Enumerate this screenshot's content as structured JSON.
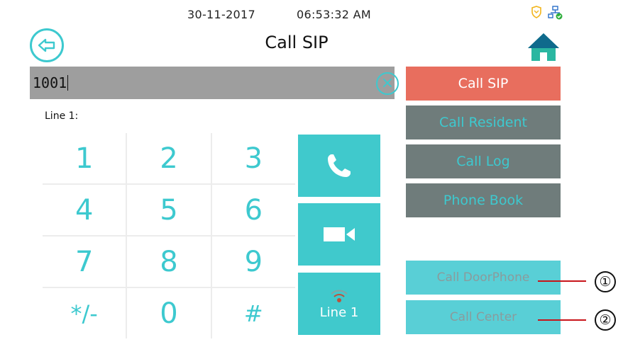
{
  "status": {
    "date": "30-11-2017",
    "time": "06:53:32  AM",
    "icons": [
      "shield-icon",
      "network-icon"
    ]
  },
  "header": {
    "title": "Call SIP",
    "back_icon": "back-arrow-icon",
    "home_icon": "home-icon"
  },
  "dial": {
    "value": "1001",
    "clear_icon": "clear-icon",
    "line_label": "Line 1:"
  },
  "keypad": {
    "keys": [
      "1",
      "2",
      "3",
      "4",
      "5",
      "6",
      "7",
      "8",
      "9",
      "*/-",
      "0",
      "#"
    ]
  },
  "actions": {
    "call_icon": "phone-icon",
    "video_icon": "video-camera-icon",
    "line_label": "Line 1"
  },
  "menu": {
    "items": [
      {
        "label": "Call SIP",
        "active": true
      },
      {
        "label": "Call Resident",
        "active": false
      },
      {
        "label": "Call Log",
        "active": false
      },
      {
        "label": "Phone Book",
        "active": false
      },
      {
        "label": "Call DoorPhone",
        "active": false
      },
      {
        "label": "Call Center",
        "active": false
      }
    ]
  },
  "callouts": [
    "①",
    "②"
  ],
  "colors": {
    "accent": "#3dc9cf",
    "active_menu": "#e86e5e",
    "menu_gray": "#6f7c7b",
    "input_bg": "#9e9e9e",
    "callout_line": "#c8141a"
  }
}
